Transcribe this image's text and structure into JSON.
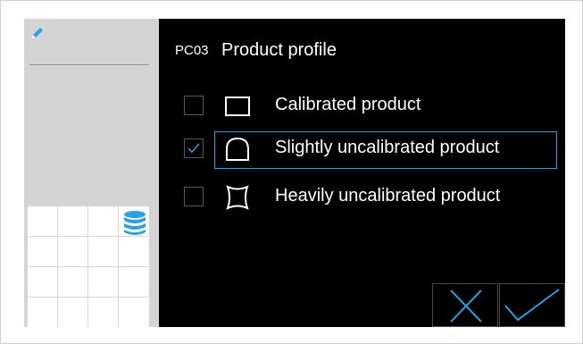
{
  "colors": {
    "accent": "#2ea0e0",
    "background": "#000000",
    "sidebar": "#d4d4d4",
    "text": "#ffffff"
  },
  "sidebar": {
    "edit_icon": "pencil-icon",
    "database_icon": "database-icon"
  },
  "header": {
    "code": "PC03",
    "title": "Product profile"
  },
  "options": [
    {
      "label": "Calibrated product",
      "checked": false,
      "icon": "square-shape-icon"
    },
    {
      "label": "Slightly uncalibrated product",
      "checked": true,
      "icon": "rounded-shape-icon"
    },
    {
      "label": "Heavily uncalibrated product",
      "checked": false,
      "icon": "irregular-shape-icon"
    }
  ],
  "actions": {
    "cancel_icon": "close-icon",
    "confirm_icon": "checkmark-icon"
  }
}
